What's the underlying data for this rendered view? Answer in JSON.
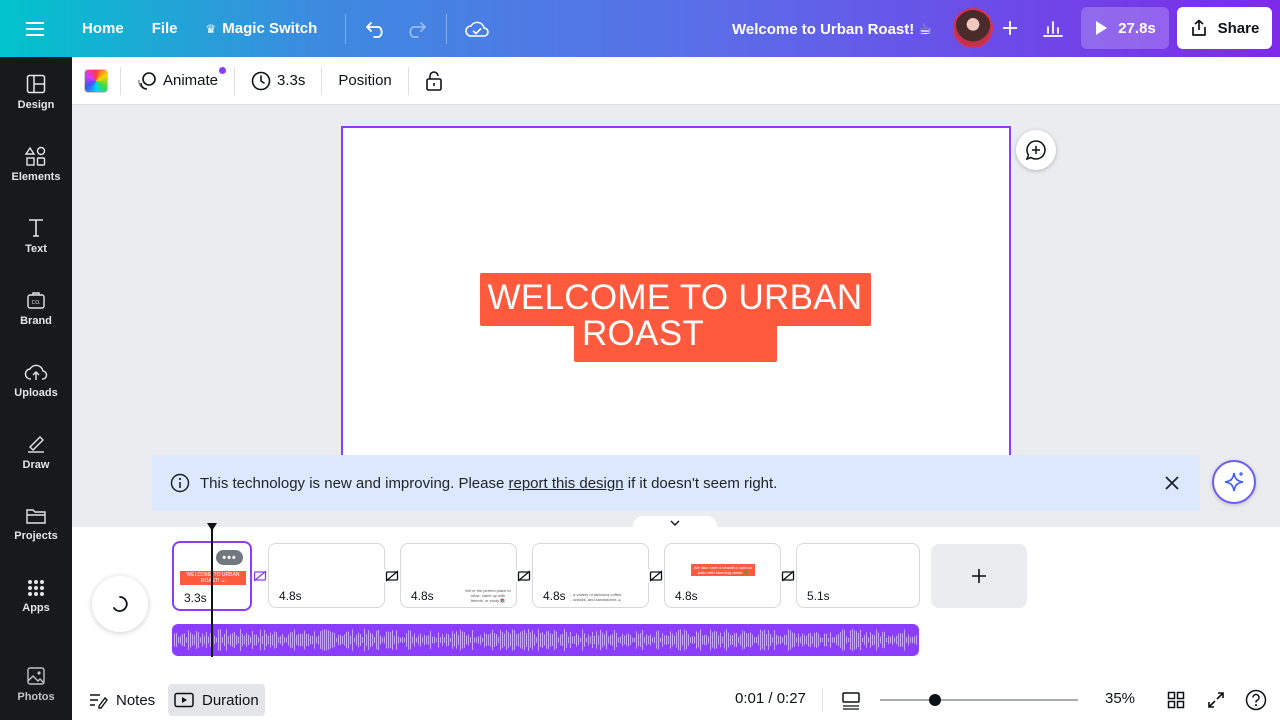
{
  "topbar": {
    "home": "Home",
    "file": "File",
    "magic_switch": "Magic Switch",
    "title": "Welcome to Urban Roast! ☕",
    "play_duration": "27.8s",
    "share": "Share"
  },
  "sidebar": {
    "items": [
      {
        "label": "Design",
        "icon": "layout-icon"
      },
      {
        "label": "Elements",
        "icon": "shapes-icon"
      },
      {
        "label": "Text",
        "icon": "text-icon"
      },
      {
        "label": "Brand",
        "icon": "brand-icon"
      },
      {
        "label": "Uploads",
        "icon": "upload-icon"
      },
      {
        "label": "Draw",
        "icon": "draw-icon"
      },
      {
        "label": "Projects",
        "icon": "folder-icon"
      },
      {
        "label": "Apps",
        "icon": "apps-icon"
      },
      {
        "label": "Photos",
        "icon": "photo-icon"
      }
    ]
  },
  "context_toolbar": {
    "animate": "Animate",
    "duration": "3.3s",
    "position": "Position"
  },
  "canvas": {
    "title_line1": "WELCOME TO URBAN",
    "title_line2": "ROAST",
    "accent": "#ff5a3d"
  },
  "banner": {
    "prefix": "This technology is new and improving. Please ",
    "link": "report this design",
    "suffix": " if it doesn't seem right."
  },
  "timeline": {
    "clips": [
      {
        "duration": "3.3s",
        "mini": "WELCOME TO URBAN ROAST! ☕"
      },
      {
        "duration": "4.8s",
        "mini": ""
      },
      {
        "duration": "4.8s",
        "mini": "We're the perfect place to relax, catch up with friends, or study 📚"
      },
      {
        "duration": "4.8s",
        "mini": "... a variety of delicious coffee ... snacks, and sandwiches ☕"
      },
      {
        "duration": "4.8s",
        "mini": "We also have a beautiful outdoor patio with stunning views 🌿"
      },
      {
        "duration": "5.1s",
        "mini": ""
      }
    ],
    "more": "•••"
  },
  "bottombar": {
    "notes": "Notes",
    "duration": "Duration",
    "time": "0:01 / 0:27",
    "zoom": "35%",
    "zoom_fraction": 0.28
  },
  "colors": {
    "brand_purple": "#8b3dff",
    "sidebar_bg": "#18191b",
    "banner_bg": "#dbe8fd"
  }
}
